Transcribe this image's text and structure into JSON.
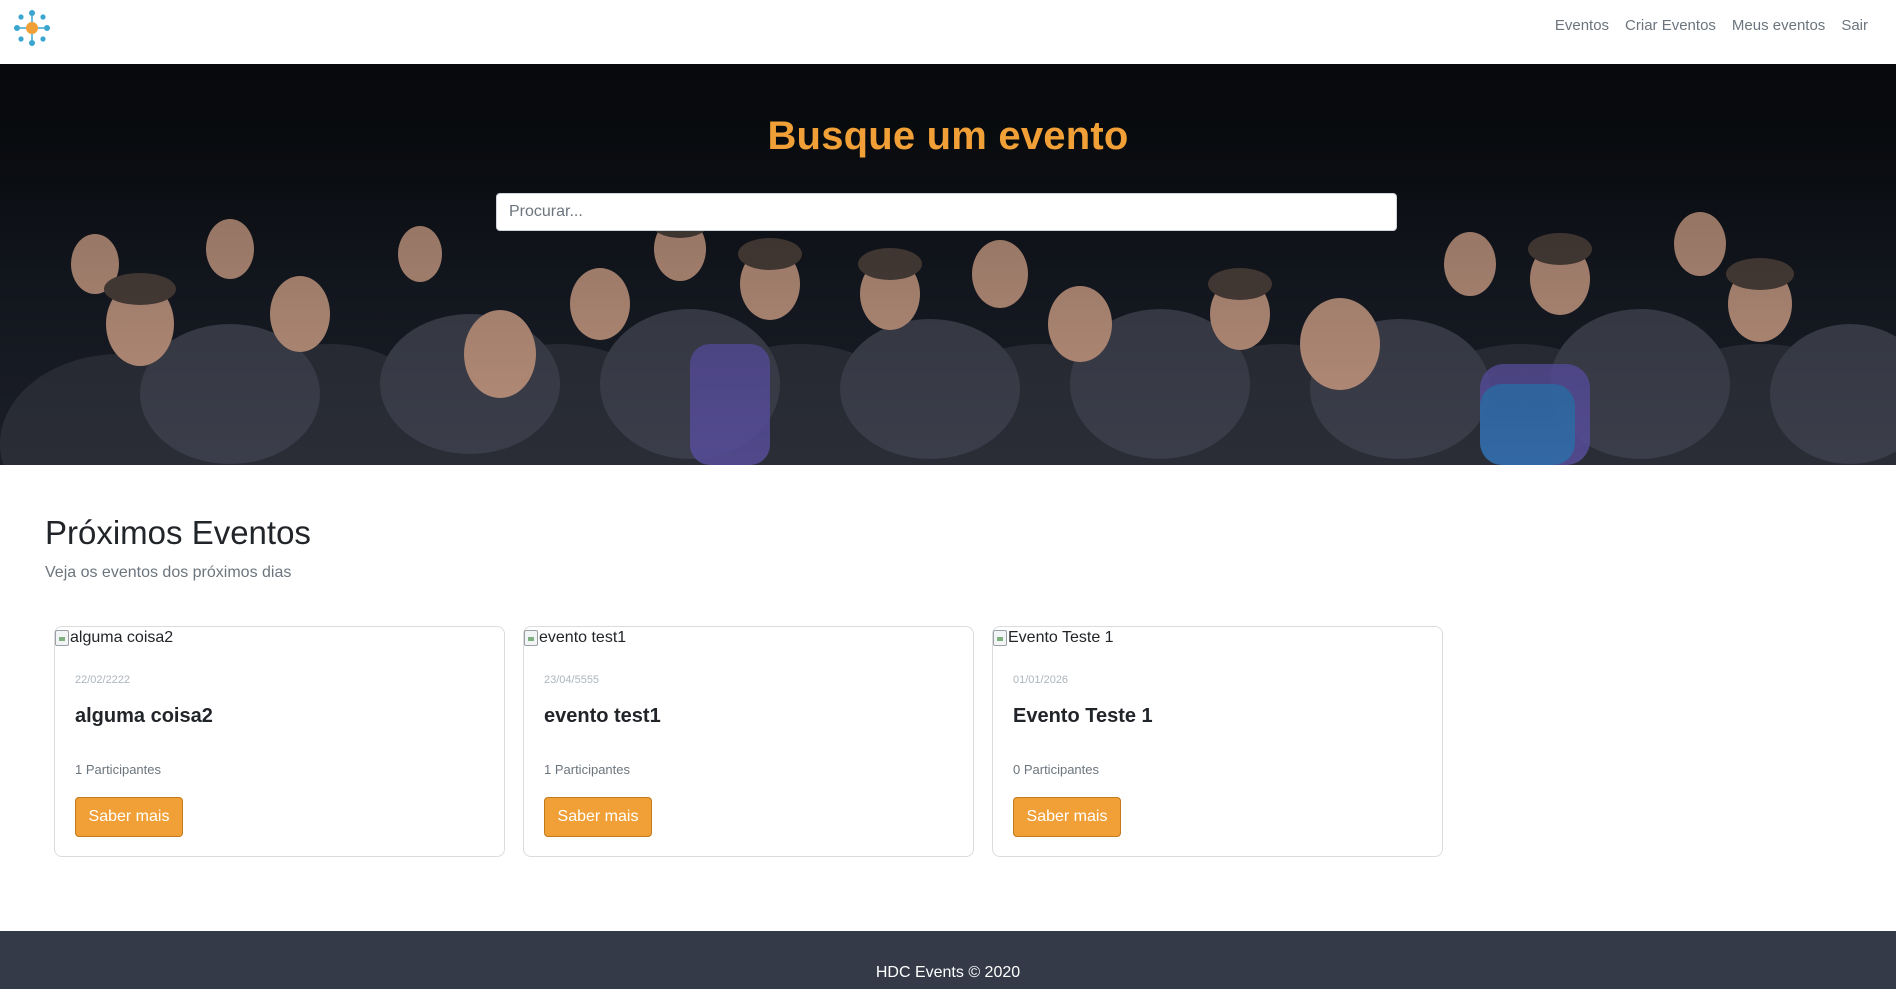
{
  "nav": {
    "logo_icon": "events-network-icon",
    "links": [
      "Eventos",
      "Criar Eventos",
      "Meus eventos",
      "Sair"
    ]
  },
  "hero": {
    "title": "Busque um evento",
    "search_placeholder": "Procurar..."
  },
  "section": {
    "title": "Próximos Eventos",
    "subtitle": "Veja os eventos dos próximos dias"
  },
  "events": [
    {
      "image_alt": "alguma coisa2",
      "date": "22/02/2222",
      "title": "alguma coisa2",
      "participants": "1 Participantes",
      "button": "Saber mais"
    },
    {
      "image_alt": "evento test1",
      "date": "23/04/5555",
      "title": "evento test1",
      "participants": "1 Participantes",
      "button": "Saber mais"
    },
    {
      "image_alt": "Evento Teste 1",
      "date": "01/01/2026",
      "title": "Evento Teste 1",
      "participants": "0 Participantes",
      "button": "Saber mais"
    }
  ],
  "footer": {
    "text": "HDC Events © 2020"
  },
  "colors": {
    "accent": "#f0a036",
    "footer_bg": "#343a48",
    "muted": "#6c757d"
  }
}
